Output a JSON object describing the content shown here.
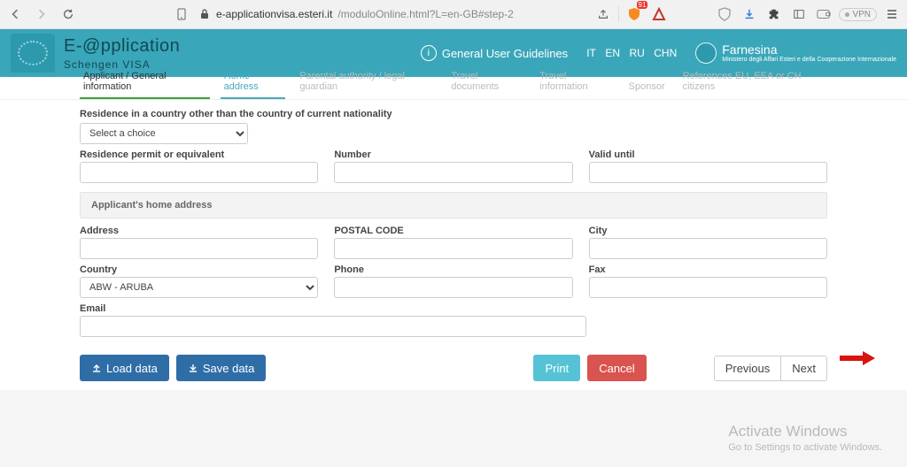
{
  "browser": {
    "url_host": "e-applicationvisa.esteri.it",
    "url_path": "/moduloOnline.html?L=en-GB#step-2",
    "vpn_label": "VPN",
    "ext_badge": "91"
  },
  "header": {
    "brand_main": "E-@pplication",
    "brand_sub": "Schengen VISA",
    "guidelines": "General User Guidelines",
    "langs": {
      "it": "IT",
      "en": "EN",
      "ru": "RU",
      "chn": "CHN"
    },
    "farnesina": "Farnesina",
    "farnesina_sub": "Ministero degli Affari Esteri\n e della Cooperazione Internazionale"
  },
  "tabs": [
    {
      "label": "Applicant / General information",
      "state": "done"
    },
    {
      "label": "Home address",
      "state": "current"
    },
    {
      "label": "Parental authority / legal guardian",
      "state": ""
    },
    {
      "label": "Travel documents",
      "state": ""
    },
    {
      "label": "Travel information",
      "state": ""
    },
    {
      "label": "Sponsor",
      "state": ""
    },
    {
      "label": "References EU, EEA or CH citizens",
      "state": ""
    }
  ],
  "section1": {
    "residence_other_label": "Residence in a country other than the country of current nationality",
    "select_placeholder": "Select a choice",
    "permit_label": "Residence permit or equivalent",
    "number_label": "Number",
    "valid_label": "Valid until"
  },
  "section2": {
    "title": "Applicant's home address",
    "address_label": "Address",
    "postal_label": "POSTAL CODE",
    "city_label": "City",
    "country_label": "Country",
    "country_value": "ABW - ARUBA",
    "phone_label": "Phone",
    "fax_label": "Fax",
    "email_label": "Email"
  },
  "buttons": {
    "load": "Load data",
    "save": "Save data",
    "print": "Print",
    "cancel": "Cancel",
    "previous": "Previous",
    "next": "Next"
  },
  "watermark": {
    "line1": "Activate Windows",
    "line2": "Go to Settings to activate Windows."
  }
}
